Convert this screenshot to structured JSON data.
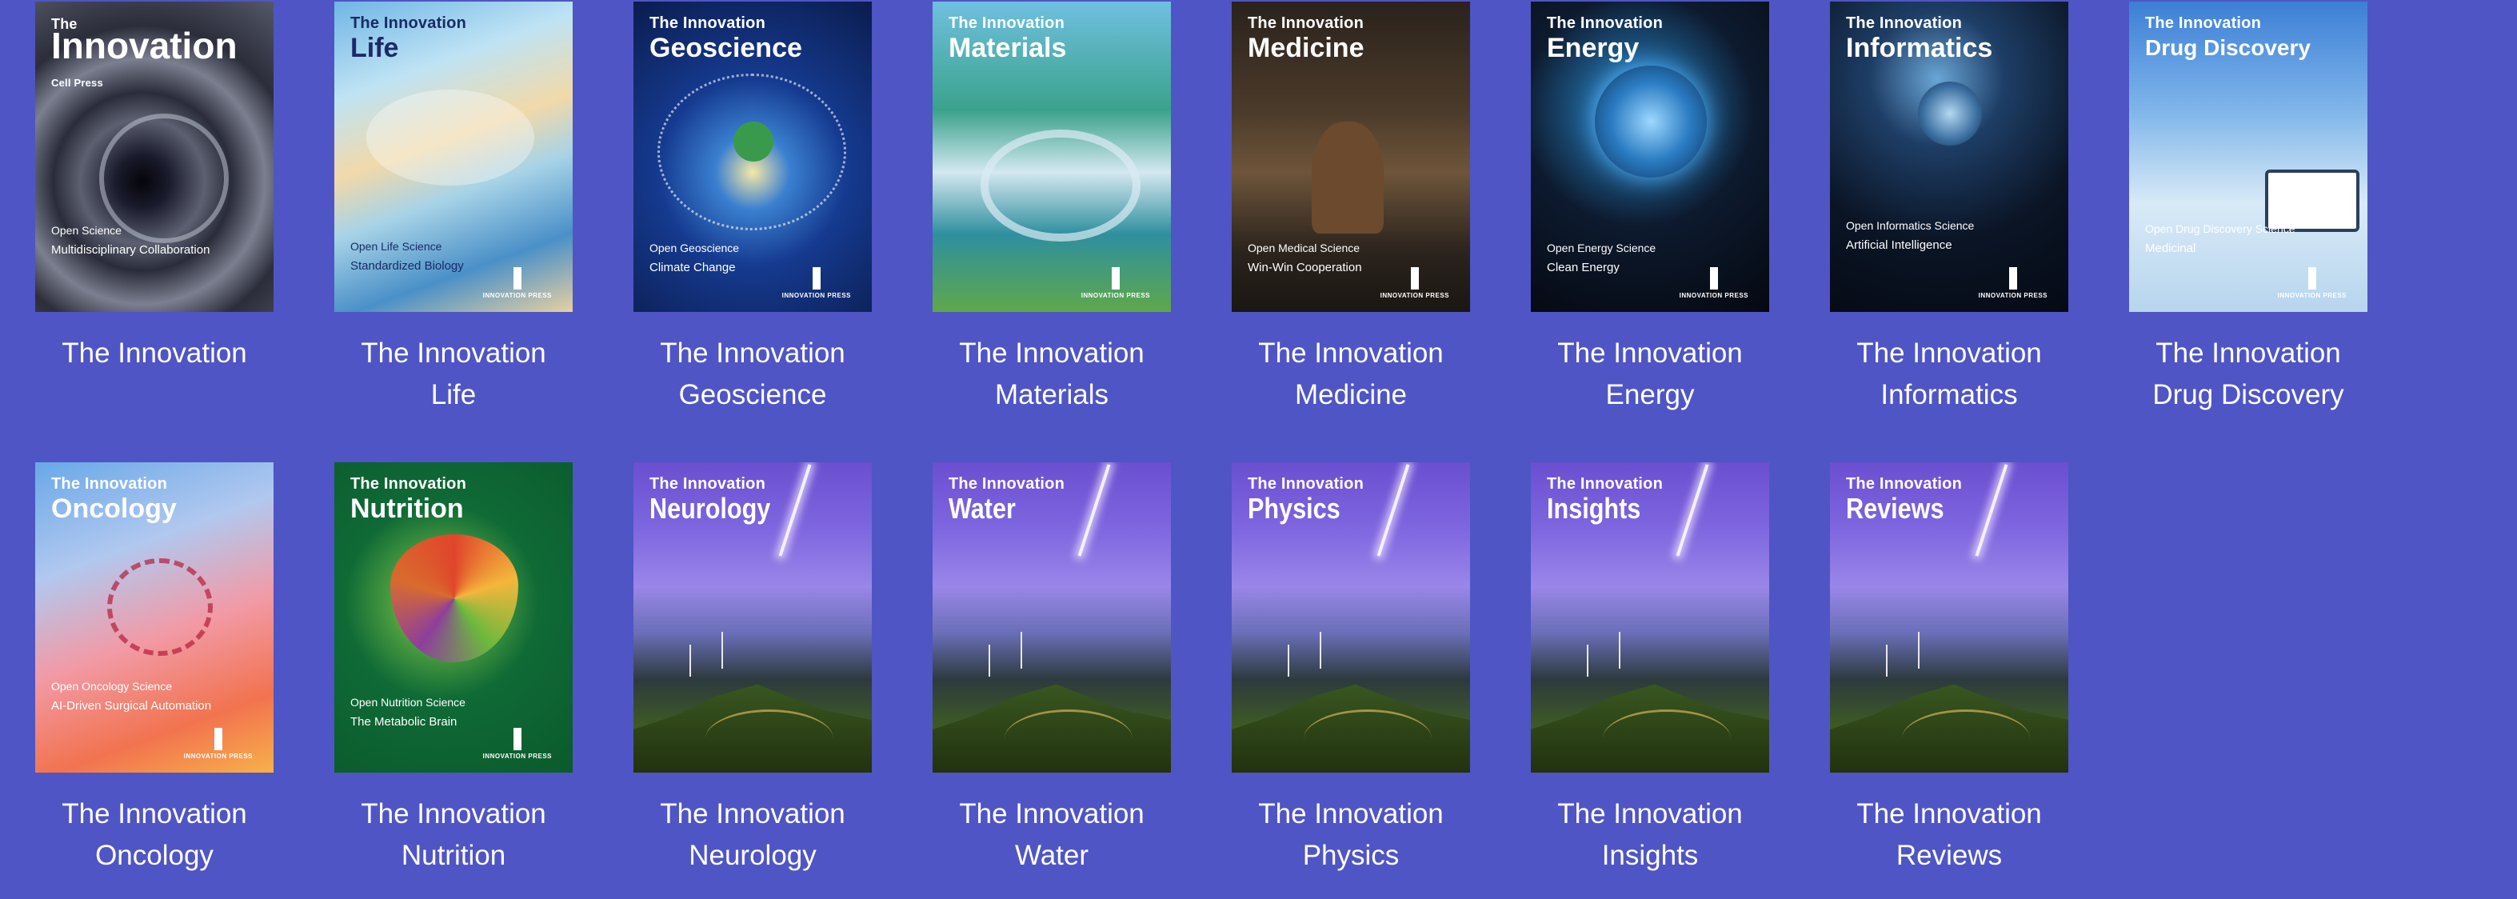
{
  "colors": {
    "page_background": "#4f55c4",
    "label_text": "#ffffff"
  },
  "journals": [
    {
      "id": "innovation",
      "label_lines": [
        "The Innovation"
      ],
      "cover": {
        "series": "The",
        "name": "Innovation",
        "brand": "Cell Press",
        "lines": [
          "Open Science",
          "Multidisciplinary Collaboration"
        ],
        "icon": "black-hole-icon"
      }
    },
    {
      "id": "life",
      "label_lines": [
        "The Innovation",
        "Life"
      ],
      "cover": {
        "series": "The Innovation",
        "name": "Life",
        "lines": [
          "Open Life Science",
          "Standardized Biology"
        ],
        "icon": "beach-scene-icon"
      }
    },
    {
      "id": "geoscience",
      "label_lines": [
        "The Innovation",
        "Geoscience"
      ],
      "cover": {
        "series": "The Innovation",
        "name": "Geoscience",
        "lines": [
          "Open Geoscience",
          "Climate Change"
        ],
        "icon": "planets-icon"
      }
    },
    {
      "id": "materials",
      "label_lines": [
        "The Innovation",
        "Materials"
      ],
      "cover": {
        "series": "The Innovation",
        "name": "Materials",
        "lines": [],
        "icon": "landscape-icon"
      }
    },
    {
      "id": "medicine",
      "label_lines": [
        "The Innovation",
        "Medicine"
      ],
      "cover": {
        "series": "The Innovation",
        "name": "Medicine",
        "lines": [
          "Open Medical Science",
          "Win-Win Cooperation"
        ],
        "icon": "notes-wall-icon"
      }
    },
    {
      "id": "energy",
      "label_lines": [
        "The Innovation",
        "Energy"
      ],
      "cover": {
        "series": "The Innovation",
        "name": "Energy",
        "lines": [
          "Open Energy Science",
          "Clean Energy"
        ],
        "icon": "light-bulb-icon"
      }
    },
    {
      "id": "informatics",
      "label_lines": [
        "The Innovation",
        "Informatics"
      ],
      "cover": {
        "series": "The Innovation",
        "name": "Informatics",
        "lines": [
          "Open Informatics Science",
          "Artificial Intelligence"
        ],
        "icon": "spiral-stair-icon"
      }
    },
    {
      "id": "drug-discovery",
      "label_lines": [
        "The Innovation",
        "Drug Discovery"
      ],
      "cover": {
        "series": "The Innovation",
        "name": "Drug Discovery",
        "lines": [
          "Open Drug Discovery Science",
          "Medicinal"
        ],
        "icon": "laboratory-icon"
      }
    },
    {
      "id": "oncology",
      "label_lines": [
        "The Innovation",
        "Oncology"
      ],
      "cover": {
        "series": "The Innovation",
        "name": "Oncology",
        "lines": [
          "Open Oncology Science",
          "AI-Driven Surgical Automation"
        ],
        "icon": "dna-helix-icon"
      }
    },
    {
      "id": "nutrition",
      "label_lines": [
        "The Innovation",
        "Nutrition"
      ],
      "cover": {
        "series": "The Innovation",
        "name": "Nutrition",
        "lines": [
          "Open Nutrition Science",
          "The Metabolic Brain"
        ],
        "icon": "food-heart-icon"
      }
    },
    {
      "id": "neurology",
      "label_lines": [
        "The Innovation",
        "Neurology"
      ],
      "cover": {
        "series": "The Innovation",
        "name": "Neurology",
        "lines": [],
        "icon": "lightning-landscape-icon"
      }
    },
    {
      "id": "water",
      "label_lines": [
        "The Innovation",
        "Water"
      ],
      "cover": {
        "series": "The Innovation",
        "name": "Water",
        "lines": [],
        "icon": "lightning-landscape-icon"
      }
    },
    {
      "id": "physics",
      "label_lines": [
        "The Innovation",
        "Physics"
      ],
      "cover": {
        "series": "The Innovation",
        "name": "Physics",
        "lines": [],
        "icon": "lightning-landscape-icon"
      }
    },
    {
      "id": "insights",
      "label_lines": [
        "The Innovation",
        "Insights"
      ],
      "cover": {
        "series": "The Innovation",
        "name": "Insights",
        "lines": [],
        "icon": "lightning-landscape-icon"
      }
    },
    {
      "id": "reviews",
      "label_lines": [
        "The Innovation",
        "Reviews"
      ],
      "cover": {
        "series": "The Innovation",
        "name": "Reviews",
        "lines": [],
        "icon": "lightning-landscape-icon"
      }
    }
  ],
  "publisher_mark": "INNOVATION PRESS"
}
